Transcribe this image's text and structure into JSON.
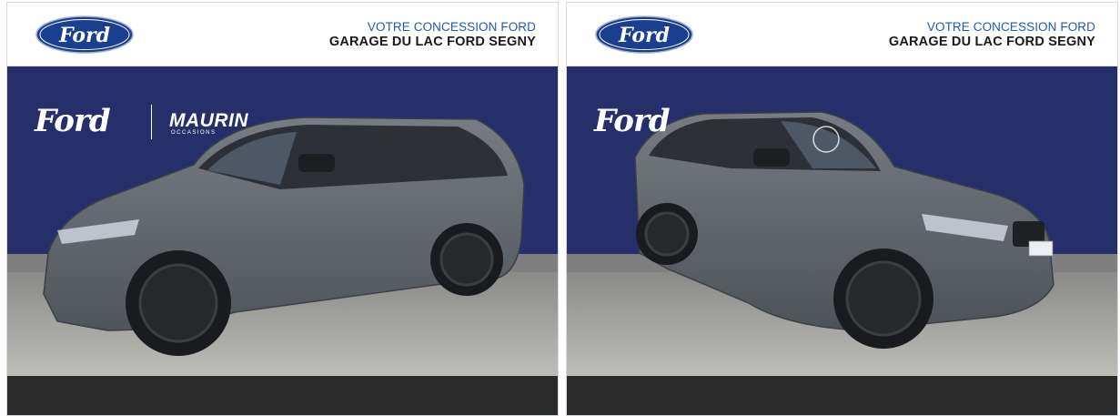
{
  "panels": [
    {
      "header": {
        "logo_text": "Ford",
        "dealer_line1": "VOTRE CONCESSION FORD",
        "dealer_line2": "GARAGE DU LAC FORD SEGNY"
      },
      "banner": {
        "brand_logo_text": "Ford",
        "partner_logo_text": "MAURIN",
        "partner_sub_text": "OCCASIONS"
      },
      "photo": {
        "subject": "grey Range Rover Sport, front three-quarter left view"
      }
    },
    {
      "header": {
        "logo_text": "Ford",
        "dealer_line1": "VOTRE CONCESSION FORD",
        "dealer_line2": "GARAGE DU LAC FORD SEGNY"
      },
      "banner": {
        "brand_logo_text": "Ford"
      },
      "photo": {
        "subject": "grey Range Rover Sport, front three-quarter right view"
      }
    }
  ],
  "colors": {
    "banner_navy": "#272f6b",
    "header_blue_text": "#1e5bb8",
    "ford_oval_blue": "#1b3f8f",
    "maurin_green": "#3aa74a",
    "footer_dark": "#2b2b2b",
    "car_grey": "#5e6369"
  }
}
